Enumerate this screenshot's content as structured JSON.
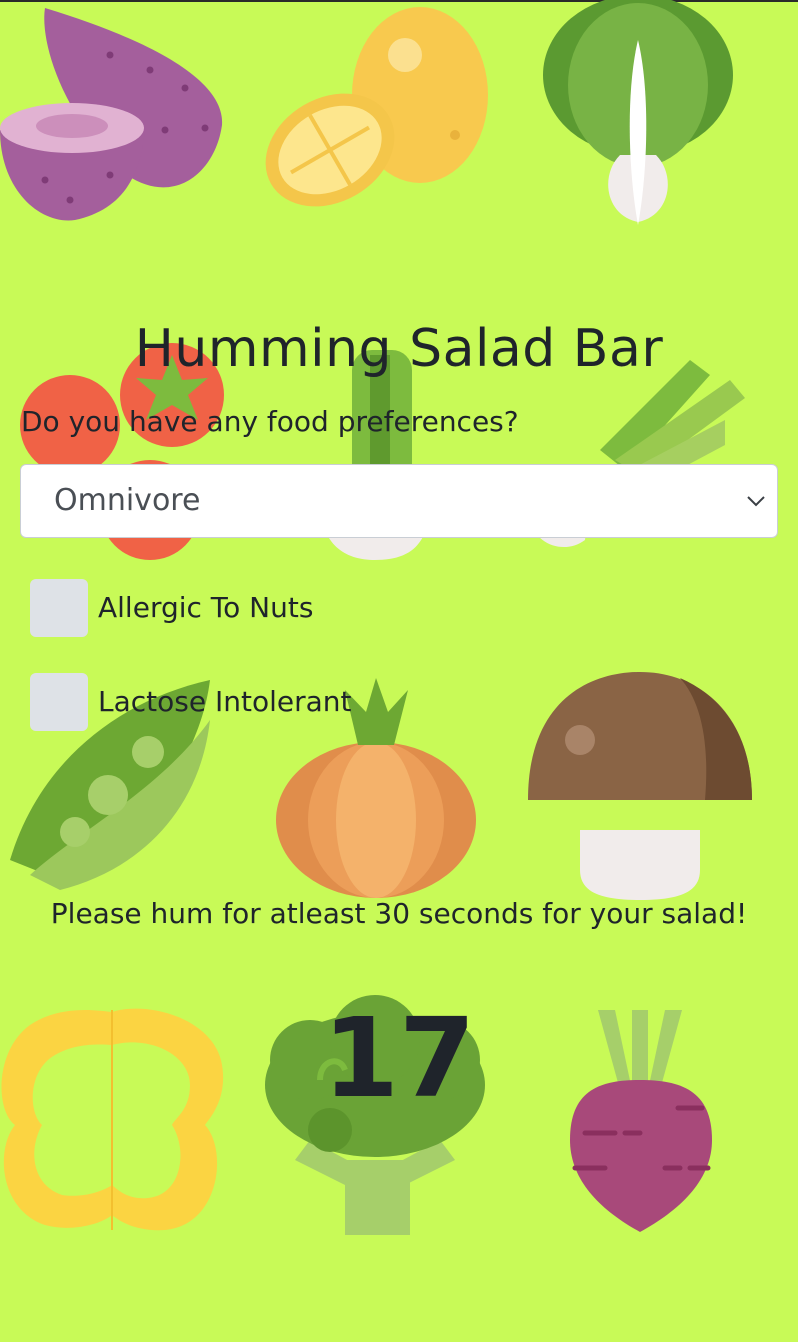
{
  "page": {
    "title": "Humming Salad Bar",
    "background_color": "#c8fa57"
  },
  "form": {
    "preference_question": "Do you have any food preferences?",
    "preference_selected": "Omnivore",
    "checkboxes": [
      {
        "label": "Allergic To Nuts",
        "checked": false
      },
      {
        "label": "Lactose Intolerant",
        "checked": false
      }
    ]
  },
  "hum": {
    "instruction": "Please hum for atleast 30 seconds for your salad!",
    "counter": "17"
  },
  "icons": [
    "sweet-potato-icon",
    "lemon-icon",
    "bok-choy-icon",
    "tomato-icon",
    "green-onion-icon",
    "leek-icon",
    "pea-pod-icon",
    "onion-icon",
    "mushroom-icon",
    "bell-pepper-icon",
    "broccoli-icon",
    "beet-icon",
    "chevron-down-icon"
  ]
}
